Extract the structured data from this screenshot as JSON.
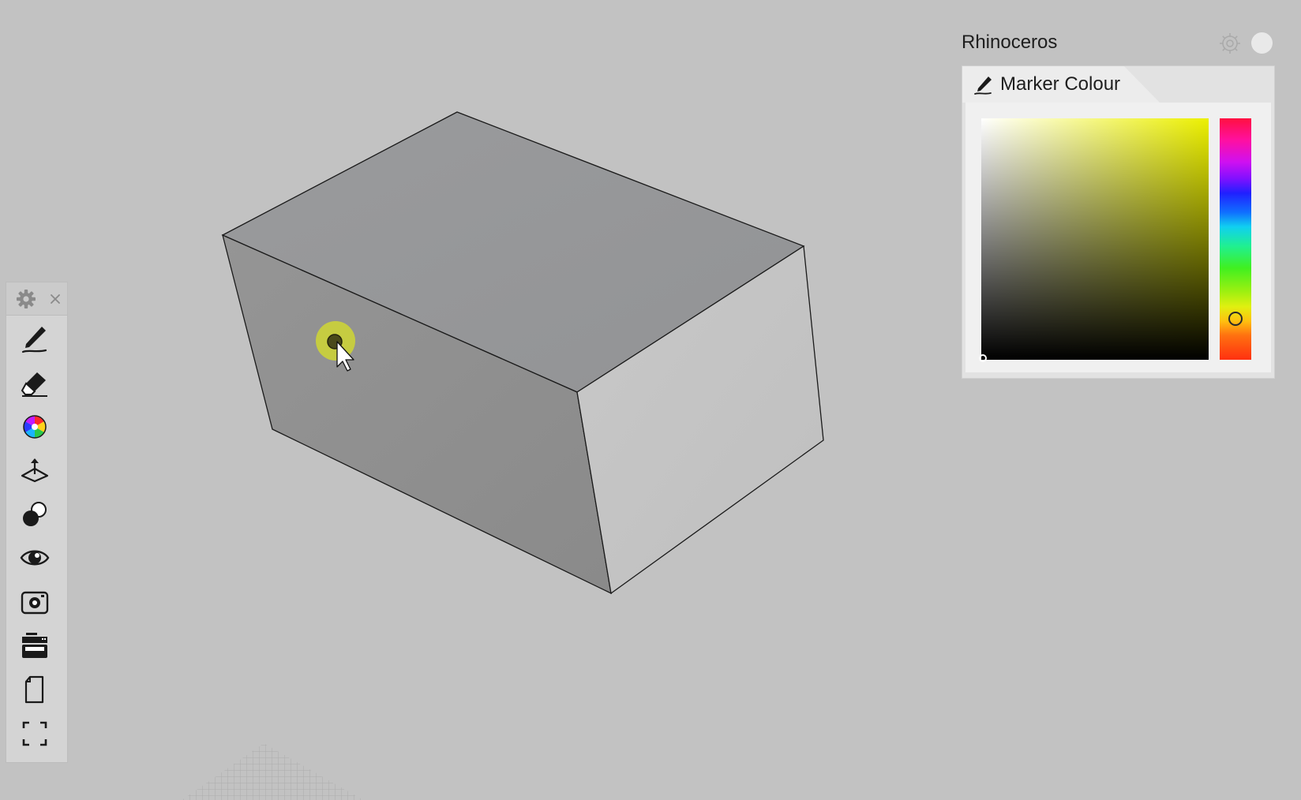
{
  "panel": {
    "title": "Rhinoceros",
    "tab_label": "Marker Colour",
    "icons": {
      "settings": "gear-icon",
      "close": "close-icon",
      "tab": "marker-pen-icon"
    },
    "selected_hue_color": "#e6f010",
    "hue_colors": [
      "#ff1040",
      "#ff10a0",
      "#d010f0",
      "#8010ff",
      "#2020ff",
      "#1070ff",
      "#10d0f0",
      "#20f090",
      "#40f020",
      "#a0f010",
      "#e0f010",
      "#ffc010",
      "#ff7010",
      "#ff3010"
    ]
  },
  "toolbar": {
    "head_icons": [
      "gear-icon",
      "close-icon"
    ],
    "tools": [
      {
        "name": "marker-tool",
        "icon": "marker-pen-icon"
      },
      {
        "name": "eraser-tool",
        "icon": "eraser-icon"
      },
      {
        "name": "colour-tool",
        "icon": "colour-wheel-icon"
      },
      {
        "name": "plane-tool",
        "icon": "plane-icon"
      },
      {
        "name": "shading-tool",
        "icon": "shading-spheres-icon"
      },
      {
        "name": "view-tool",
        "icon": "eye-icon"
      },
      {
        "name": "capture-tool",
        "icon": "camera-icon"
      },
      {
        "name": "printer-tool",
        "icon": "printer-icon"
      },
      {
        "name": "page-tool",
        "icon": "page-icon"
      },
      {
        "name": "fullscreen-tool",
        "icon": "fullscreen-icon"
      }
    ]
  },
  "viewport": {
    "object": "box",
    "colors": {
      "background": "#c2c2c2",
      "top_face": "#97989a",
      "left_face": "#8f8f8f",
      "right_face": "#c4c4c4",
      "marker": "#e6f010"
    }
  }
}
